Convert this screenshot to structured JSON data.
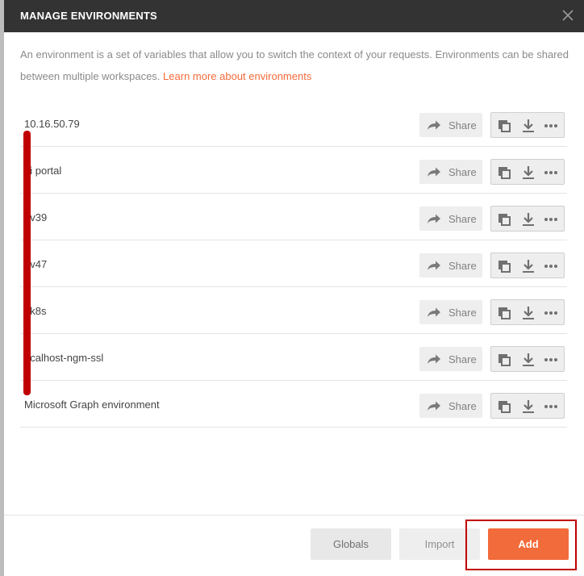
{
  "dialog": {
    "title": "MANAGE ENVIRONMENTS",
    "description": "An environment is a set of variables that allow you to switch the context of your requests. Environments can be shared between multiple workspaces.",
    "learn_more_link": "Learn more about environments"
  },
  "environments": [
    {
      "name": "10.16.50.79",
      "share_label": "Share"
    },
    {
      "name": "pi portal",
      "share_label": "Share"
    },
    {
      "name": "ev39",
      "share_label": "Share"
    },
    {
      "name": "ev47",
      "share_label": "Share"
    },
    {
      "name": "9k8s",
      "share_label": "Share"
    },
    {
      "name": "ocalhost-ngm-ssl",
      "share_label": "Share"
    },
    {
      "name": "Microsoft Graph environment",
      "share_label": "Share"
    }
  ],
  "footer": {
    "globals_label": "Globals",
    "import_label": "Import",
    "add_label": "Add"
  },
  "icons": {
    "close": "close-icon",
    "share": "share-arrow-icon",
    "duplicate": "duplicate-icon",
    "download": "download-icon",
    "more": "more-options-icon"
  },
  "colors": {
    "accent": "#f26b3a",
    "titlebar": "#333333",
    "annotation": "#c00000"
  }
}
